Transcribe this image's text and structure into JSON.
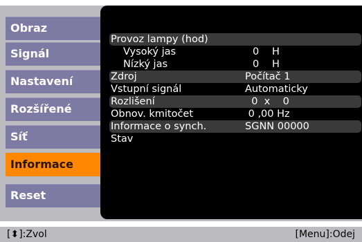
{
  "sidebar": {
    "items": [
      {
        "label": "Obraz"
      },
      {
        "label": "Signál"
      },
      {
        "label": "Nastavení"
      },
      {
        "label": "Rozšířené"
      },
      {
        "label": "Síť"
      },
      {
        "label": "Informace"
      },
      {
        "label": "Reset"
      }
    ],
    "active_index": 5
  },
  "info": {
    "lamp_hours_label": "Provoz lampy (hod)",
    "high_brightness_label": "Vysoký jas",
    "high_brightness_value": "0",
    "high_brightness_unit": "H",
    "low_brightness_label": "Nízký jas",
    "low_brightness_value": "0",
    "low_brightness_unit": "H",
    "source_label": "Zdroj",
    "source_value": "Počítač 1",
    "input_signal_label": "Vstupní signál",
    "input_signal_value": "Automaticky",
    "resolution_label": "Rozlišení",
    "resolution_value": "  0  x    0",
    "refresh_rate_label": "Obnov. kmitočet",
    "refresh_rate_value": " 0 ,00 Hz",
    "sync_info_label": "Informace o synch.",
    "sync_info_value": "SGNN 00000",
    "status_label": "Stav"
  },
  "footer": {
    "select_hint": "[⬍]:Zvol",
    "menu_hint": "[Menu]:Odej"
  },
  "colors": {
    "tab": "#7d7aa4",
    "active_tab": "#ff8800",
    "panel": "#bcbcc0",
    "content_bg": "#000000"
  }
}
